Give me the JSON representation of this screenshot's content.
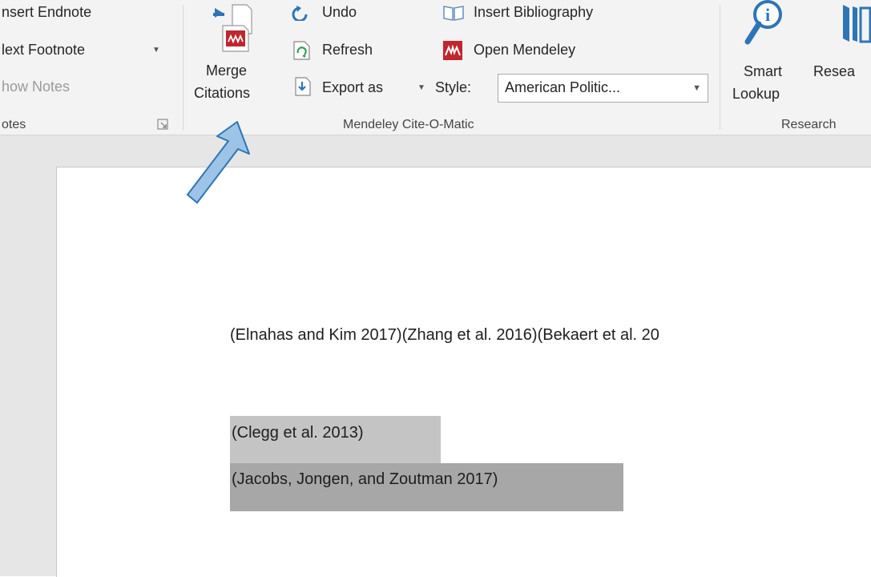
{
  "ribbon": {
    "footnotes_group": {
      "insert_endnote": "nsert Endnote",
      "next_footnote": "lext Footnote",
      "show_notes": "how Notes",
      "label": "otes"
    },
    "mendeley_group": {
      "merge_label": "Merge",
      "citations_label": "Citations",
      "undo": "Undo",
      "refresh": "Refresh",
      "export_as": "Export as",
      "insert_bibliography": "Insert Bibliography",
      "open_mendeley": "Open Mendeley",
      "style_label": "Style:",
      "style_value": "American Politic...",
      "label": "Mendeley Cite-O-Matic"
    },
    "research_group": {
      "smart_label": "Smart",
      "lookup_label": "Lookup",
      "researcher_label": "Resea",
      "label": "Research"
    }
  },
  "document": {
    "line1": "(Elnahas and Kim 2017)(Zhang et al. 2016)(Bekaert et al. 20",
    "line2": "(Clegg et al. 2013)",
    "line3": "(Jacobs, Jongen, and Zoutman 2017)"
  },
  "colors": {
    "arrow_fill": "#9dc3e6",
    "arrow_stroke": "#2e75b6",
    "mendeley_red": "#c0262d",
    "highlight_light": "#c4c4c4",
    "highlight_dark": "#a7a7a7"
  },
  "icons": [
    "merge-citations-icon",
    "undo-icon",
    "refresh-icon",
    "export-icon",
    "insert-bibliography-icon",
    "open-mendeley-icon",
    "smart-lookup-icon",
    "researcher-icon",
    "dialog-launcher-icon",
    "annotation-arrow"
  ]
}
